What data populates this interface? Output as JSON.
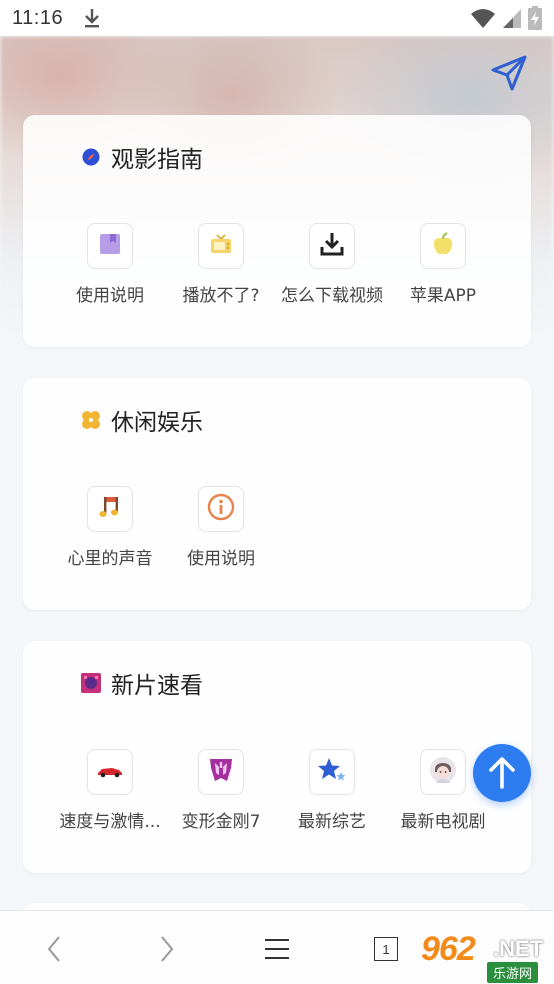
{
  "status": {
    "time": "11:16"
  },
  "sections": [
    {
      "title": "观影指南",
      "items": [
        {
          "label": "使用说明",
          "icon": "bookmark-purple-icon"
        },
        {
          "label": "播放不了?",
          "icon": "tv-yellow-icon"
        },
        {
          "label": "怎么下载视频",
          "icon": "download-icon"
        },
        {
          "label": "苹果APP",
          "icon": "apple-icon"
        }
      ]
    },
    {
      "title": "休闲娱乐",
      "items": [
        {
          "label": "心里的声音",
          "icon": "music-note-icon"
        },
        {
          "label": "使用说明",
          "icon": "info-icon"
        }
      ]
    },
    {
      "title": "新片速看",
      "items": [
        {
          "label": "速度与激情...",
          "icon": "race-car-icon"
        },
        {
          "label": "变形金刚7",
          "icon": "transformers-icon"
        },
        {
          "label": "最新综艺",
          "icon": "star-icon"
        },
        {
          "label": "最新电视剧",
          "icon": "avatar-icon"
        }
      ]
    }
  ],
  "toolbar": {
    "tab_count": "1"
  },
  "watermark": {
    "logo": "962",
    "net": ".NET",
    "sub": "乐游网"
  },
  "colors": {
    "accent": "#2d7cf0",
    "send": "#2f5fd0"
  }
}
